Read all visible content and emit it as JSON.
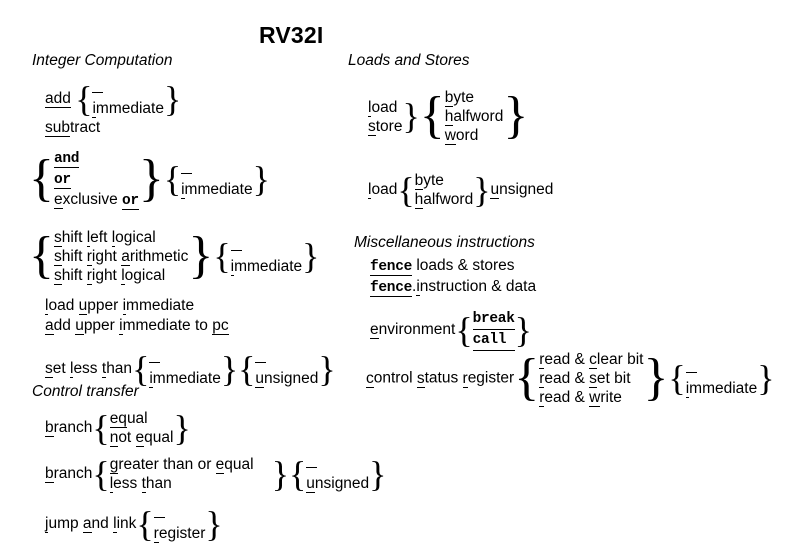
{
  "document": {
    "title": "RV32I",
    "type": "RISC-V RV32I instruction mnemonic chart"
  },
  "sections": {
    "integer_computation": "Integer Computation",
    "control_transfer": "Control transfer",
    "loads_and_stores": "Loads and Stores",
    "misc": "Miscellaneous instructions"
  },
  "left": {
    "add": "add",
    "add_brace": {
      "top": "–",
      "bottom_u": "i",
      "bottom_rest": "mmediate"
    },
    "subtract": {
      "u": "sub",
      "rest": "tract"
    },
    "logic": {
      "and": "and",
      "or": "or",
      "xor_u1": "e",
      "xor_mid": "xclusive ",
      "xor_u2": "or",
      "imm_top": "–",
      "imm_u": "i",
      "imm_rest": "mmediate"
    },
    "shift": {
      "line1": {
        "u1": "s",
        "t1": "hift ",
        "u2": "l",
        "t2": "eft ",
        "u3": "l",
        "t3": "ogical"
      },
      "line2": {
        "u1": "s",
        "t1": "hift ",
        "u2": "r",
        "t2": "ight ",
        "u3": "a",
        "t3": "rithmetic"
      },
      "line3": {
        "u1": "s",
        "t1": "hift ",
        "u2": "r",
        "t2": "ight ",
        "u3": "l",
        "t3": "ogical"
      },
      "imm_top": "–",
      "imm_u": "i",
      "imm_rest": "mmediate"
    },
    "lui": {
      "u1": "l",
      "t1": "oad ",
      "u2": "u",
      "t2": "pper ",
      "u3": "i",
      "t3": "mmediate"
    },
    "auipc": {
      "u1": "a",
      "t1": "dd ",
      "u2": "u",
      "t2": "pper ",
      "u3": "i",
      "t3": "mmediate to ",
      "u4": "pc"
    },
    "slt": {
      "u1": "s",
      "t1": "et ",
      "u2": "l",
      "t2": "ess ",
      "u3": "t",
      "t3": "han",
      "imm_top": "–",
      "imm_u": "i",
      "imm_rest": "mmediate",
      "uns_top": "–",
      "uns_u": "u",
      "uns_rest": "nsigned"
    },
    "branch1": {
      "u": "b",
      "rest": "ranch",
      "opt1_u": "eq",
      "opt1_a": "",
      "opt1_rest": "ual",
      "opt1_pre": "",
      "opt1_mid": "",
      "opt2_u1": "n",
      "opt2_t1": "ot ",
      "opt2_u2": "e",
      "opt2_t2": "qual"
    },
    "branch2": {
      "u": "b",
      "rest": "ranch",
      "opt1_u1": "g",
      "opt1_t1": "reater than or ",
      "opt1_u2": "e",
      "opt1_t2": "qual",
      "opt2_u1": "l",
      "opt2_t1": "ess ",
      "opt2_u2": "t",
      "opt2_t2": "han",
      "uns_top": "–",
      "uns_u": "u",
      "uns_rest": "nsigned"
    },
    "jal": {
      "u1": "j",
      "t1": "ump ",
      "u2": "a",
      "t2": "nd ",
      "u3": "l",
      "t3": "ink",
      "opt_top": "–",
      "opt_u": "r",
      "opt_rest": "egister"
    }
  },
  "right": {
    "loadstore": {
      "load_u": "l",
      "load_rest": "oad",
      "store_u": "s",
      "store_rest": "tore",
      "w1_u": "b",
      "w1_rest": "yte",
      "w2_u": "h",
      "w2_rest": "alfword",
      "w3_u": "w",
      "w3_rest": "ord"
    },
    "loadu": {
      "load_u": "l",
      "load_rest": "oad",
      "w1_u": "b",
      "w1_rest": "yte",
      "w2_u": "h",
      "w2_rest": "alfword",
      "uns_u": "u",
      "uns_rest": "nsigned"
    },
    "fence": {
      "u": "fence",
      "rest": " loads & stores"
    },
    "fencei": {
      "u1": "fence",
      "dot": ".",
      "u2": "i",
      "rest": "nstruction & data"
    },
    "env": {
      "u": "e",
      "rest": "nvironment",
      "opt1": "break",
      "opt2": "call"
    },
    "csr": {
      "u1": "c",
      "t1": "ontrol ",
      "u2": "s",
      "t2": "tatus ",
      "u3": "r",
      "t3": "egister",
      "o1_u1": "r",
      "o1_t1": "ead & ",
      "o1_u2": "c",
      "o1_t2": "lear bit",
      "o2_u1": "r",
      "o2_t1": "ead & ",
      "o2_u2": "s",
      "o2_t2": "et bit",
      "o3_u1": "r",
      "o3_t1": "ead & ",
      "o3_u2": "w",
      "o3_t2": "rite",
      "imm_top": "–",
      "imm_u": "i",
      "imm_rest": "mmediate"
    }
  },
  "colors": {
    "text": "#000000",
    "background": "#ffffff"
  }
}
